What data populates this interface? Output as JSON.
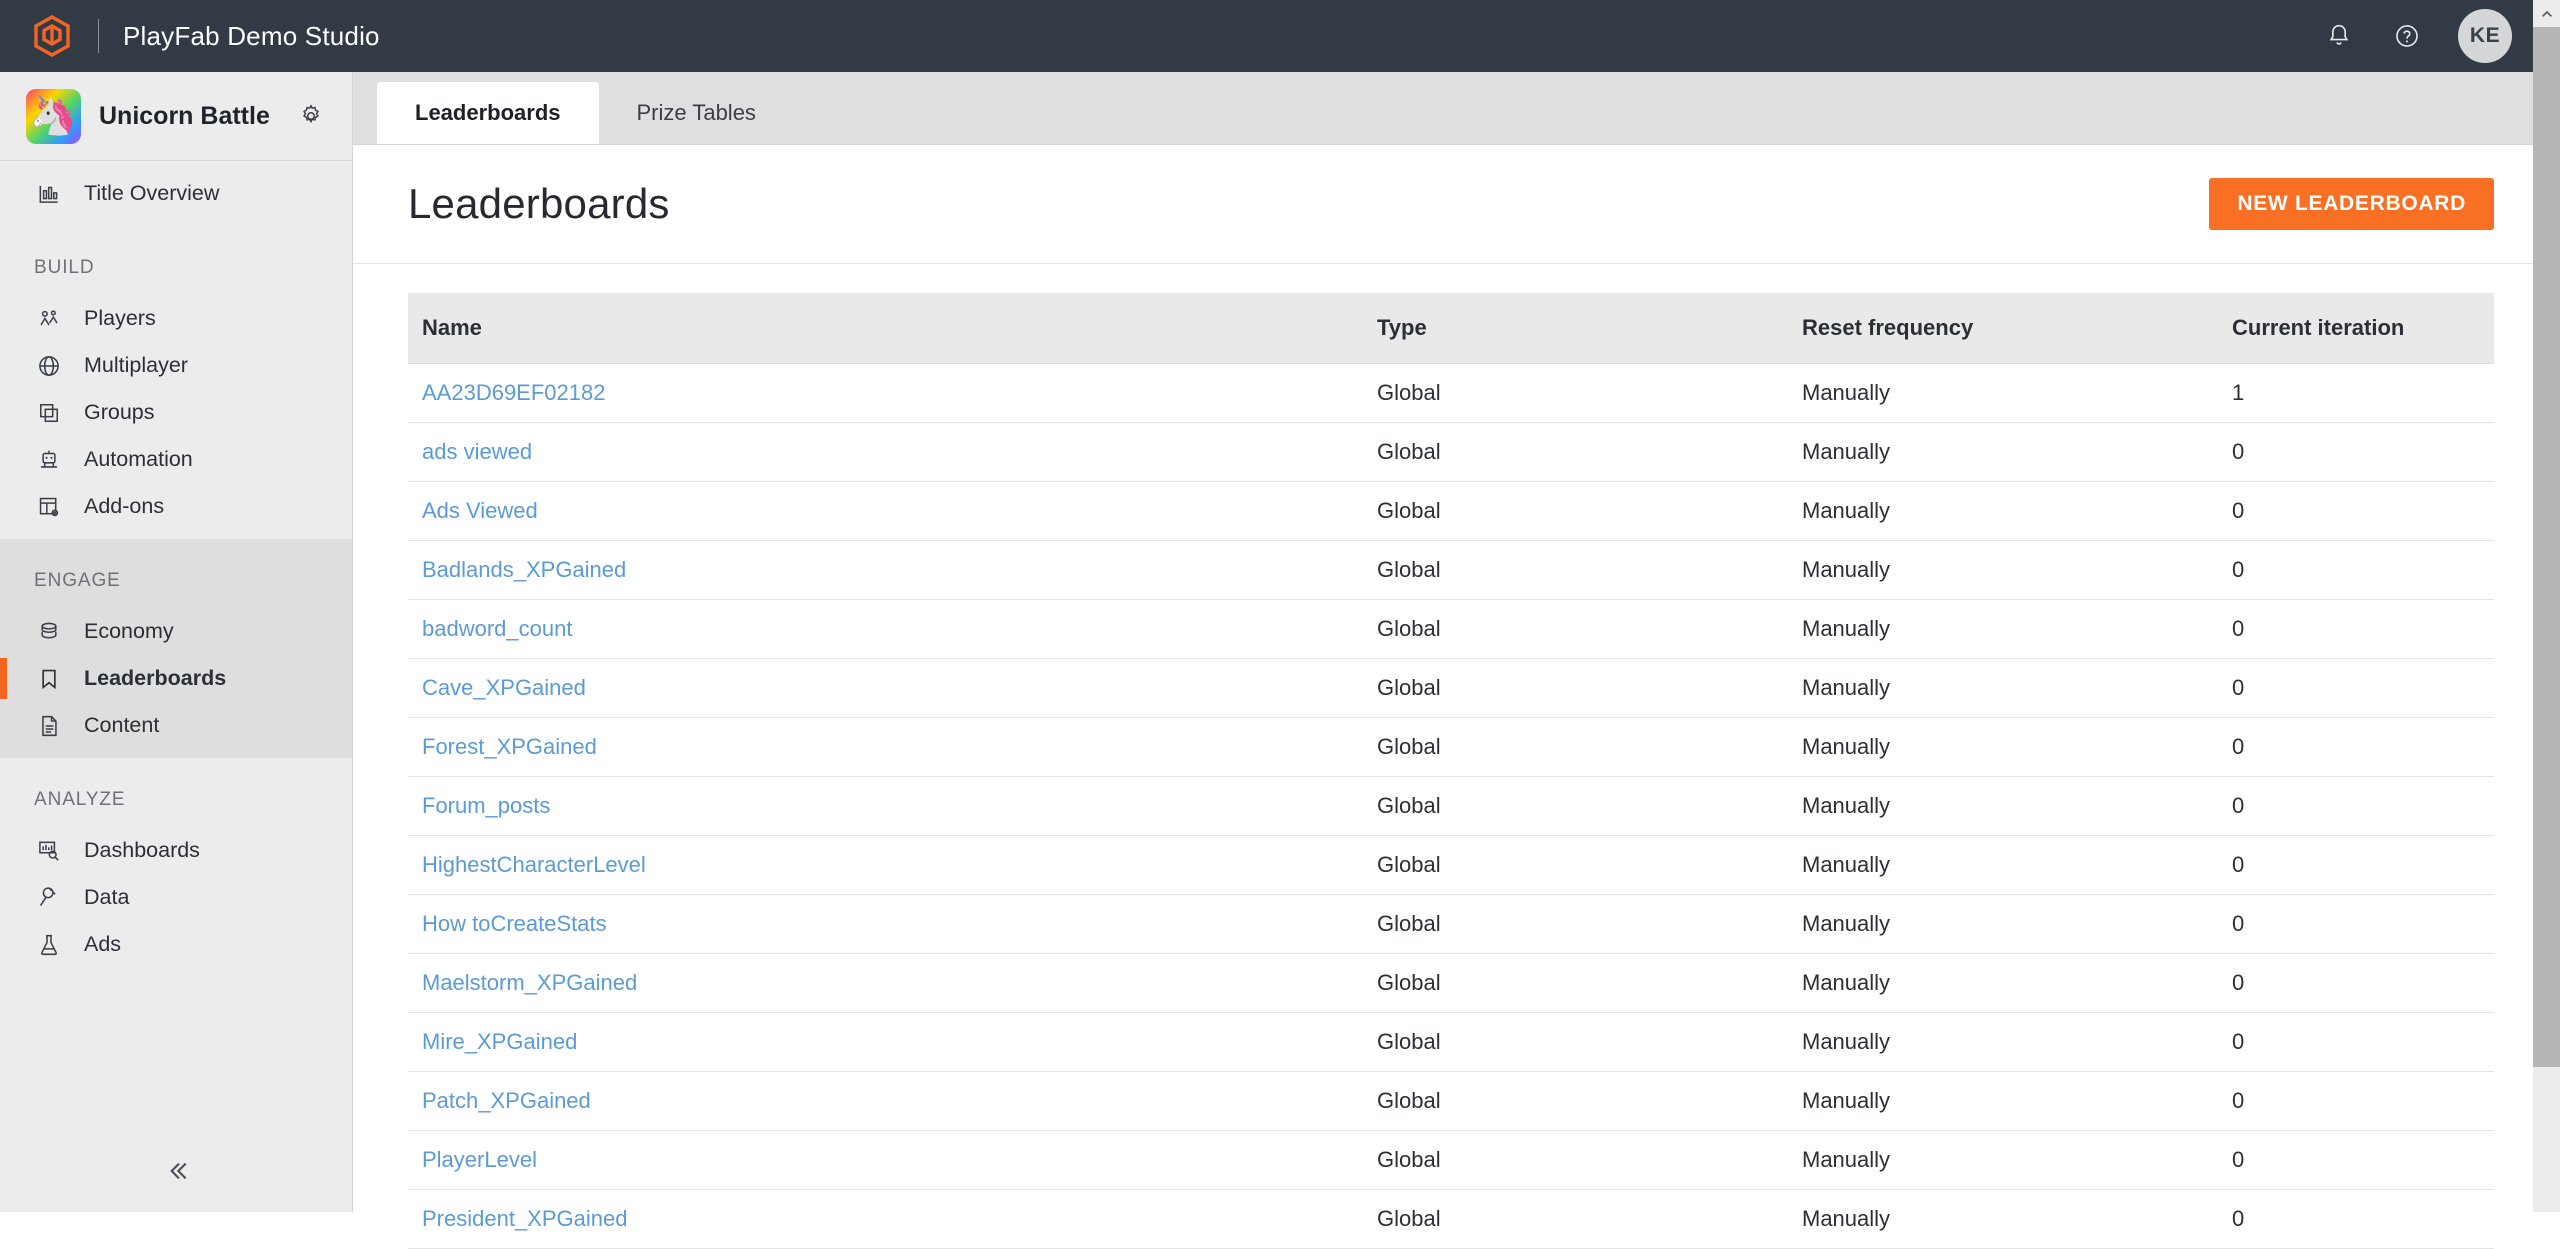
{
  "topbar": {
    "product_name": "PlayFab Demo Studio",
    "logo_icon": "playfab-hex-logo-icon",
    "notifications_icon": "bell-icon",
    "help_icon": "question-circle-icon",
    "avatar_initials": "KE",
    "accent_color": "#f26522",
    "background_color": "#323a45"
  },
  "sidebar": {
    "title_name": "Unicorn Battle",
    "title_thumb_icon": "unicorn-avatar-icon",
    "settings_icon": "gear-icon",
    "collapse_icon": "double-chevron-left-icon",
    "overview": {
      "label": "Title Overview",
      "icon": "bar-chart-icon"
    },
    "groups": [
      {
        "label": "BUILD",
        "items": [
          {
            "label": "Players",
            "icon": "people-icon"
          },
          {
            "label": "Multiplayer",
            "icon": "globe-icon"
          },
          {
            "label": "Groups",
            "icon": "stacked-squares-icon"
          },
          {
            "label": "Automation",
            "icon": "robot-icon"
          },
          {
            "label": "Add-ons",
            "icon": "grid-gear-icon"
          }
        ]
      },
      {
        "label": "ENGAGE",
        "items": [
          {
            "label": "Economy",
            "icon": "database-icon",
            "active": false
          },
          {
            "label": "Leaderboards",
            "icon": "bookmark-icon",
            "active": true
          },
          {
            "label": "Content",
            "icon": "document-icon",
            "active": false
          }
        ]
      },
      {
        "label": "ANALYZE",
        "items": [
          {
            "label": "Dashboards",
            "icon": "chart-search-icon"
          },
          {
            "label": "Data",
            "icon": "plug-icon"
          },
          {
            "label": "Ads",
            "icon": "flask-icon"
          }
        ]
      }
    ]
  },
  "main": {
    "tabs": [
      {
        "label": "Leaderboards",
        "active": true
      },
      {
        "label": "Prize Tables",
        "active": false
      }
    ],
    "page_title": "Leaderboards",
    "new_button_label": "NEW LEADERBOARD",
    "table": {
      "columns": [
        "Name",
        "Type",
        "Reset frequency",
        "Current iteration"
      ],
      "rows": [
        {
          "name": "AA23D69EF02182",
          "type": "Global",
          "reset": "Manually",
          "iteration": "1"
        },
        {
          "name": "ads viewed",
          "type": "Global",
          "reset": "Manually",
          "iteration": "0"
        },
        {
          "name": "Ads Viewed",
          "type": "Global",
          "reset": "Manually",
          "iteration": "0"
        },
        {
          "name": "Badlands_XPGained",
          "type": "Global",
          "reset": "Manually",
          "iteration": "0"
        },
        {
          "name": "badword_count",
          "type": "Global",
          "reset": "Manually",
          "iteration": "0"
        },
        {
          "name": "Cave_XPGained",
          "type": "Global",
          "reset": "Manually",
          "iteration": "0"
        },
        {
          "name": "Forest_XPGained",
          "type": "Global",
          "reset": "Manually",
          "iteration": "0"
        },
        {
          "name": "Forum_posts",
          "type": "Global",
          "reset": "Manually",
          "iteration": "0"
        },
        {
          "name": "HighestCharacterLevel",
          "type": "Global",
          "reset": "Manually",
          "iteration": "0"
        },
        {
          "name": "How toCreateStats",
          "type": "Global",
          "reset": "Manually",
          "iteration": "0"
        },
        {
          "name": "Maelstorm_XPGained",
          "type": "Global",
          "reset": "Manually",
          "iteration": "0"
        },
        {
          "name": "Mire_XPGained",
          "type": "Global",
          "reset": "Manually",
          "iteration": "0"
        },
        {
          "name": "Patch_XPGained",
          "type": "Global",
          "reset": "Manually",
          "iteration": "0"
        },
        {
          "name": "PlayerLevel",
          "type": "Global",
          "reset": "Manually",
          "iteration": "0"
        },
        {
          "name": "President_XPGained",
          "type": "Global",
          "reset": "Manually",
          "iteration": "0"
        }
      ]
    }
  },
  "scrollbar": {
    "up_arrow_icon": "chevron-up-icon"
  }
}
